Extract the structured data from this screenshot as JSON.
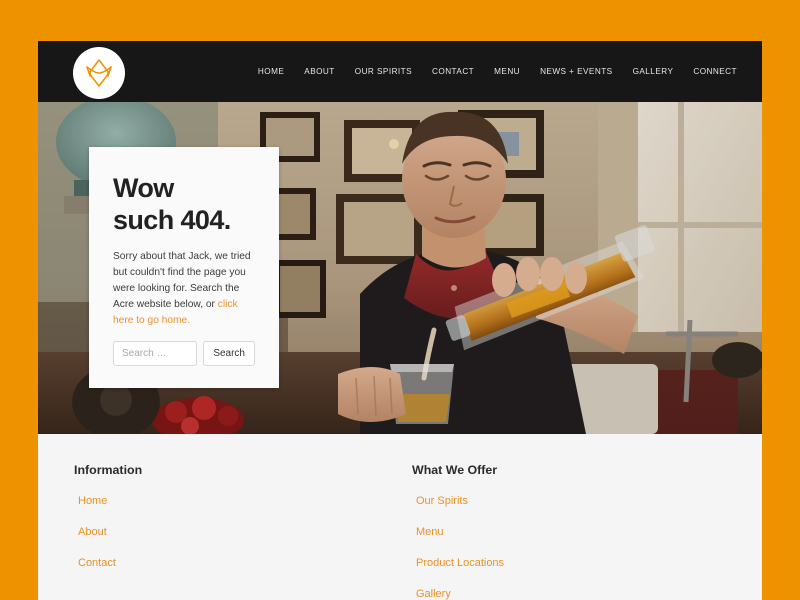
{
  "theme": {
    "page_background": "#ef9200",
    "header_background": "#171717",
    "footer_background": "#f5f5f5",
    "accent": "#e8912a",
    "nav_text": "#e9e6e1",
    "card_background": "#fafafa"
  },
  "header": {
    "logo": {
      "icon": "acre-monogram-logo-icon",
      "shape": "circle",
      "mark_color": "#ef9200"
    },
    "nav": [
      {
        "label": "HOME"
      },
      {
        "label": "ABOUT"
      },
      {
        "label": "OUR SPIRITS"
      },
      {
        "label": "CONTACT"
      },
      {
        "label": "MENU"
      },
      {
        "label": "NEWS + EVENTS"
      },
      {
        "label": "GALLERY"
      },
      {
        "label": "CONNECT"
      }
    ]
  },
  "hero": {
    "image_description": "Man in dark vest and red shirt pouring amber whiskey from a glass decanter into a tumbler in a warmly lit room with framed pictures on the wall"
  },
  "error_card": {
    "title_line1": "Wow",
    "title_line2": "such 404.",
    "message": "Sorry about that Jack, we tried but couldn't find the page you were looking for. Search the Acre website below, or ",
    "home_link_label": "click here to go home.",
    "search": {
      "placeholder": "Search …",
      "value": "",
      "submit_label": "Search"
    }
  },
  "footer": {
    "columns": [
      {
        "heading": "Information",
        "links": [
          {
            "label": "Home"
          },
          {
            "label": "About"
          },
          {
            "label": "Contact"
          }
        ]
      },
      {
        "heading": "What We Offer",
        "links": [
          {
            "label": "Our Spirits"
          },
          {
            "label": "Menu"
          },
          {
            "label": "Product Locations"
          },
          {
            "label": "Gallery"
          }
        ]
      }
    ]
  }
}
